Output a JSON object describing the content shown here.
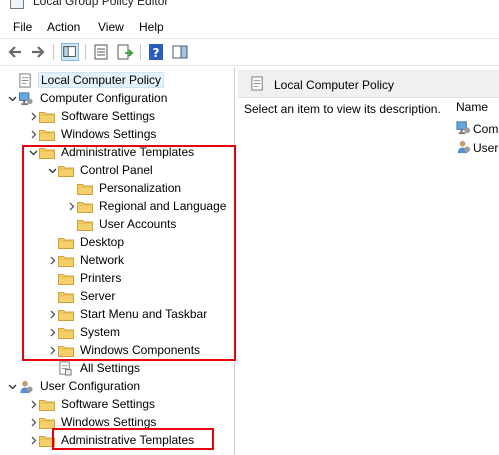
{
  "window": {
    "title": "Local Group Policy Editor"
  },
  "menu": [
    "File",
    "Action",
    "View",
    "Help"
  ],
  "toolbar": {
    "buttons": [
      "back-icon",
      "forward-icon",
      "show-hide-tree-icon",
      "properties-icon",
      "export-list-icon",
      "help-icon",
      "show-action-pane-icon"
    ]
  },
  "tree": {
    "root": "Local Computer Policy",
    "computer_configuration": "Computer Configuration",
    "cc_software_settings": "Software Settings",
    "cc_windows_settings": "Windows Settings",
    "cc_administrative_templates": "Administrative Templates",
    "control_panel": "Control Panel",
    "personalization": "Personalization",
    "regional_and_language": "Regional and Language",
    "user_accounts": "User Accounts",
    "desktop": "Desktop",
    "network": "Network",
    "printers": "Printers",
    "server": "Server",
    "start_menu_and_taskbar": "Start Menu and Taskbar",
    "system": "System",
    "windows_components": "Windows Components",
    "all_settings": "All Settings",
    "user_configuration": "User Configuration",
    "uc_software_settings": "Software Settings",
    "uc_windows_settings": "Windows Settings",
    "uc_administrative_templates": "Administrative Templates"
  },
  "details": {
    "title": "Local Computer Policy",
    "description": "Select an item to view its description.",
    "column_name": "Name",
    "items": [
      "Com",
      "User"
    ]
  },
  "colors": {
    "highlight": "#e8000d",
    "folder": "#f5cf6b",
    "selection": "#e5f1fb"
  }
}
